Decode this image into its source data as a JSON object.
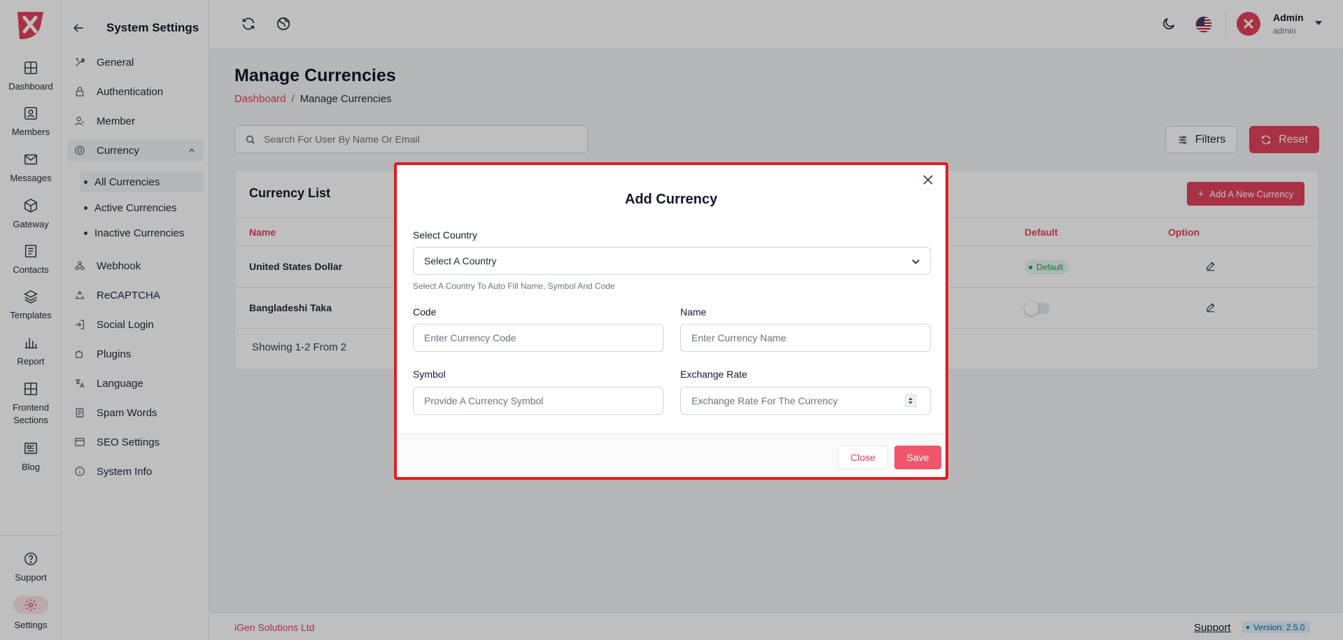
{
  "brand": {
    "logo_letter": "X",
    "accent": "#e0435a"
  },
  "rail": {
    "items": [
      {
        "label": "Dashboard",
        "icon": "grid-icon"
      },
      {
        "label": "Members",
        "icon": "member-card-icon"
      },
      {
        "label": "Messages",
        "icon": "mail-icon"
      },
      {
        "label": "Gateway",
        "icon": "box-icon"
      },
      {
        "label": "Contacts",
        "icon": "contacts-icon"
      },
      {
        "label": "Templates",
        "icon": "layers-icon"
      },
      {
        "label": "Report",
        "icon": "bar-chart-icon"
      },
      {
        "label_line1": "Frontend",
        "label_line2": "Sections",
        "icon": "layout-icon"
      },
      {
        "label": "Blog",
        "icon": "newspaper-icon"
      }
    ],
    "bottom": [
      {
        "label": "Support",
        "icon": "help-circle-icon"
      },
      {
        "label": "Settings",
        "icon": "gear-icon"
      }
    ]
  },
  "sidebar": {
    "title": "System Settings",
    "items": {
      "general": "General",
      "authentication": "Authentication",
      "member": "Member",
      "currency": "Currency",
      "webhook": "Webhook",
      "recaptcha": "ReCAPTCHA",
      "social_login": "Social Login",
      "plugins": "Plugins",
      "language": "Language",
      "spam_words": "Spam Words",
      "seo_settings": "SEO Settings",
      "system_info": "System Info"
    },
    "currency_sub": {
      "all": "All Currencies",
      "active": "Active Currencies",
      "inactive": "Inactive Currencies"
    }
  },
  "topbar": {
    "user_name": "Admin",
    "user_role": "admin"
  },
  "page": {
    "title": "Manage Currencies",
    "breadcrumb_home": "Dashboard",
    "breadcrumb_sep": "/",
    "breadcrumb_current": "Manage Currencies",
    "search_placeholder": "Search For User By Name Or Email",
    "filters_label": "Filters",
    "reset_label": "Reset"
  },
  "card": {
    "title": "Currency List",
    "add_label": "Add A New Currency",
    "add_plus": "+",
    "columns": {
      "name": "Name",
      "default": "Default",
      "option": "Option"
    },
    "rows": [
      {
        "name": "United States Dollar",
        "default_badge": "Default"
      },
      {
        "name": "Bangladeshi Taka"
      }
    ],
    "showing": "Showing 1-2 From 2"
  },
  "footer": {
    "company": "iGen Solutions Ltd",
    "support": "Support",
    "version": "Version: 2.5.0"
  },
  "modal": {
    "title": "Add Currency",
    "select_country_label": "Select Country",
    "select_country_value": "Select A Country",
    "select_country_hint": "Select A Country To Auto Fill Name, Symbol And Code",
    "code_label": "Code",
    "code_placeholder": "Enter Currency Code",
    "name_label": "Name",
    "name_placeholder": "Enter Currency Name",
    "symbol_label": "Symbol",
    "symbol_placeholder": "Provide A Currency Symbol",
    "rate_label": "Exchange Rate",
    "rate_placeholder": "Exchange Rate For The Currency",
    "close_label": "Close",
    "save_label": "Save",
    "highlight_color": "#e31b23"
  }
}
